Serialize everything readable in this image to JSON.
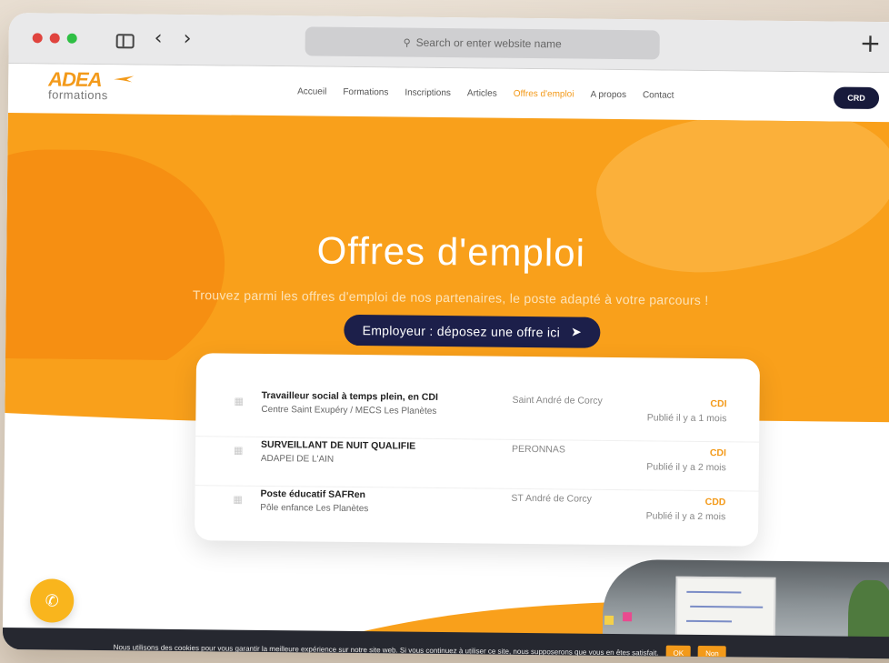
{
  "browser": {
    "address_placeholder": "Search or enter website name",
    "back_icon": "chevron-left-icon",
    "forward_icon": "chevron-right-icon",
    "new_tab_icon": "plus-icon",
    "sidebar_icon": "sidebar-icon"
  },
  "site": {
    "logo_main": "ADEA",
    "logo_sub": "formations",
    "menu": [
      {
        "label": "Accueil"
      },
      {
        "label": "Formations"
      },
      {
        "label": "Inscriptions"
      },
      {
        "label": "Articles"
      },
      {
        "label": "Offres d'emploi"
      },
      {
        "label": "A propos"
      },
      {
        "label": "Contact"
      }
    ],
    "active_menu_index": 4,
    "crd_label": "CRD"
  },
  "hero": {
    "title": "Offres d'emploi",
    "subtitle": "Trouvez parmi les offres d'emploi de nos partenaires, le poste adapté à votre parcours !",
    "cta_label": "Employeur : déposez une offre ici"
  },
  "jobs": [
    {
      "title": "Travailleur social à temps plein, en CDI",
      "organization": "Centre Saint Exupéry / MECS Les Planètes",
      "location": "Saint André de Corcy",
      "contract": "CDI",
      "posted": "Publié il y a 1 mois"
    },
    {
      "title": "SURVEILLANT DE NUIT QUALIFIE",
      "organization": "ADAPEI DE L'AIN",
      "location": "PERONNAS",
      "contract": "CDI",
      "posted": "Publié il y a 2 mois"
    },
    {
      "title": "Poste éducatif SAFRen",
      "organization": "Pôle enfance Les Planètes",
      "location": "ST André de Corcy",
      "contract": "CDD",
      "posted": "Publié il y a 2 mois"
    }
  ],
  "cookie": {
    "text": "Nous utilisons des cookies pour vous garantir la meilleure expérience sur notre site web. Si vous continuez à utiliser ce site, nous supposerons que vous en êtes satisfait.",
    "ok_label": "OK",
    "no_label": "Non"
  },
  "colors": {
    "brand_orange": "#f9a01b",
    "accent_orange": "#f39a1a",
    "navy": "#1c1f4a"
  }
}
